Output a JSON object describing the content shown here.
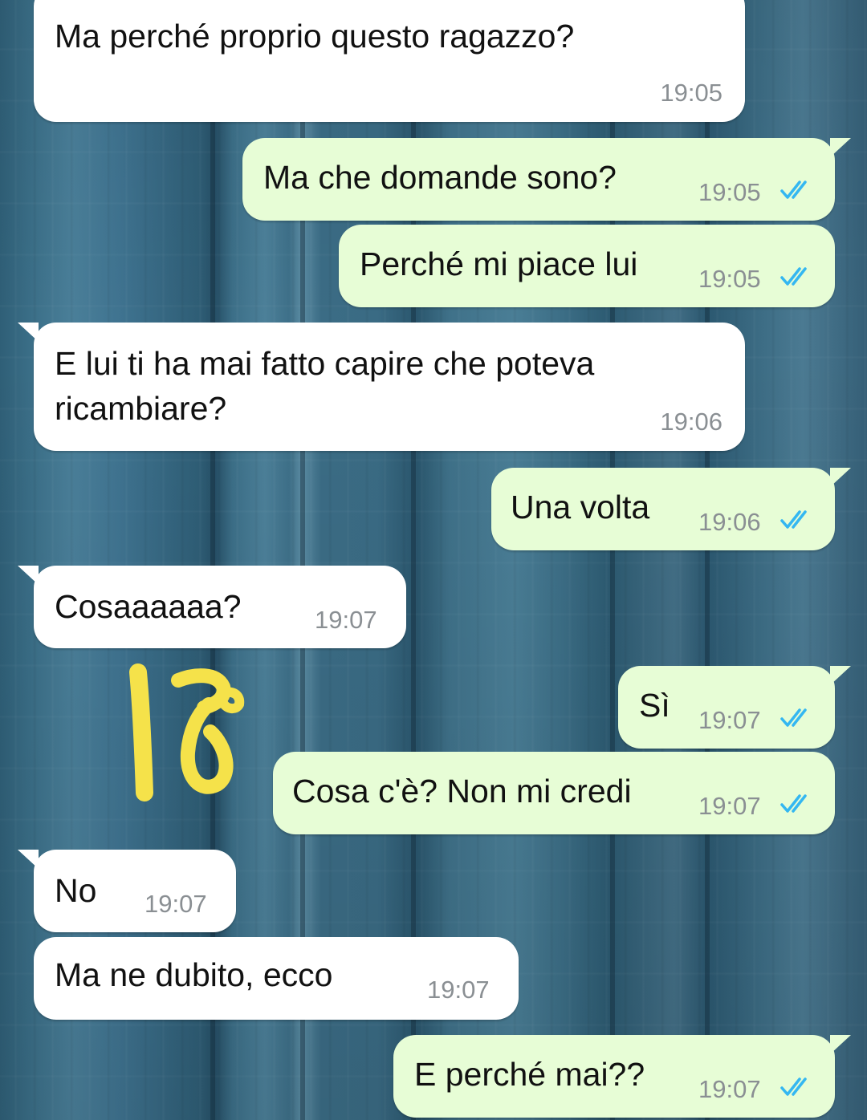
{
  "chat": {
    "messages": [
      {
        "text": "Ma perché proprio questo ragazzo?",
        "time": "19:05",
        "direction": "incoming"
      },
      {
        "text": "Ma che domande sono?",
        "time": "19:05",
        "direction": "outgoing",
        "status": "read-ticks-icon"
      },
      {
        "text": "Perché mi piace lui",
        "time": "19:05",
        "direction": "outgoing",
        "status": "read-ticks-icon"
      },
      {
        "text": "E lui ti ha mai fatto capire che poteva",
        "text_line2": "ricambiare?",
        "time": "19:06",
        "direction": "incoming"
      },
      {
        "text": "Una volta",
        "time": "19:06",
        "direction": "outgoing",
        "status": "read-ticks-icon"
      },
      {
        "text": "Cosaaaaaa?",
        "time": "19:07",
        "direction": "incoming"
      },
      {
        "text": "Sì",
        "time": "19:07",
        "direction": "outgoing",
        "status": "read-ticks-icon"
      },
      {
        "text": "Cosa c'è? Non mi credi",
        "time": "19:07",
        "direction": "outgoing",
        "status": "read-ticks-icon"
      },
      {
        "text": "No",
        "time": "19:07",
        "direction": "incoming"
      },
      {
        "text": "Ma ne dubito, ecco",
        "time": "19:07",
        "direction": "incoming"
      },
      {
        "text": "E perché mai??",
        "time": "19:07",
        "direction": "outgoing",
        "status": "read-ticks-icon"
      }
    ]
  },
  "annotation": {
    "text": "18",
    "color": "#f5e24a"
  },
  "colors": {
    "incoming_bubble": "#ffffff",
    "outgoing_bubble": "#e7fdd6",
    "timestamp": "#8a8f93",
    "read_ticks": "#34b7f1",
    "wallpaper": "#3f6f86"
  }
}
